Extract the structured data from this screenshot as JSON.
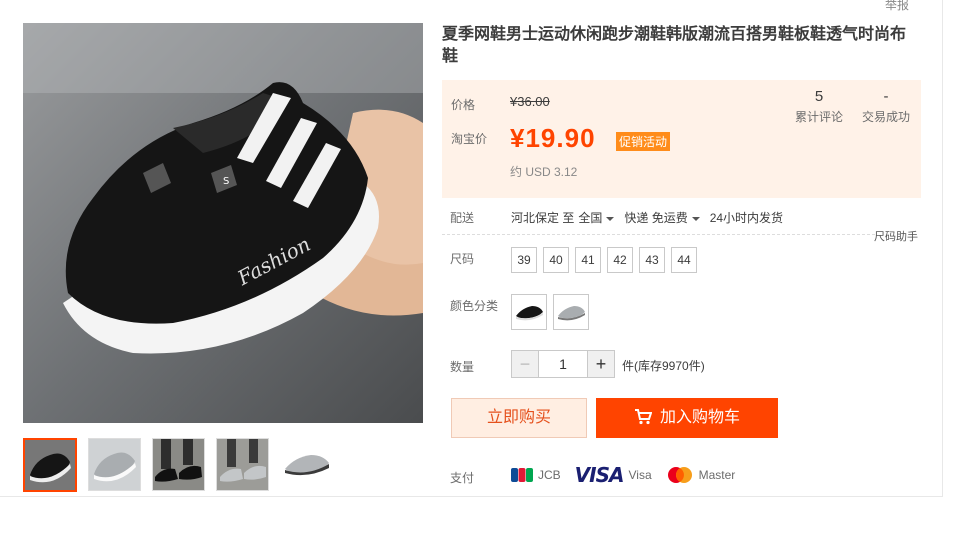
{
  "header": {
    "report_link": "举报"
  },
  "product": {
    "title": "夏季网鞋男士运动休闲跑步潮鞋韩版潮流百搭男鞋板鞋透气时尚布鞋",
    "thumbnails": [
      "shoe-black-white",
      "shoe-grey",
      "shoe-black-worn",
      "shoe-grey-worn",
      "shoe-grey-side"
    ]
  },
  "price": {
    "orig_label": "价格",
    "orig_value": "¥36.00",
    "promo_label": "淘宝价",
    "promo_value": "¥19.90",
    "promo_badge": "促销活动",
    "usd": "约 USD 3.12"
  },
  "stats": {
    "reviews_count": "5",
    "reviews_label": "累计评论",
    "deals_count": "-",
    "deals_label": "交易成功"
  },
  "shipping": {
    "label": "配送",
    "from": "河北保定 至",
    "to": "全国",
    "method": "快递 免运费",
    "dispatch": "24小时内发货"
  },
  "size": {
    "label": "尺码",
    "helper": "尺码助手",
    "options": [
      "39",
      "40",
      "41",
      "42",
      "43",
      "44"
    ]
  },
  "color": {
    "label": "颜色分类",
    "options": [
      "black",
      "grey"
    ]
  },
  "quantity": {
    "label": "数量",
    "minus": "−",
    "plus": "+",
    "value": "1",
    "stock": "件(库存9970件)"
  },
  "actions": {
    "buy_now": "立即购买",
    "add_to_cart": "加入购物车"
  },
  "payment": {
    "label": "支付",
    "jcb_label": "JCB",
    "visa_logo": "VISA",
    "visa_label": "Visa",
    "master_label": "Master"
  },
  "colors": {
    "accent": "#ff4400",
    "price_bg": "#fff2e8",
    "badge": "#ff8c1a"
  }
}
